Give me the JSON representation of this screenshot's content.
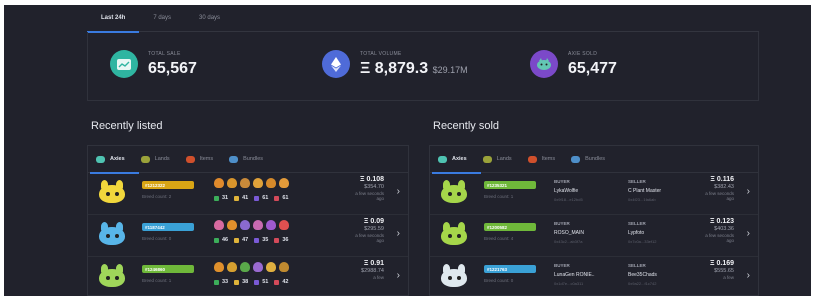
{
  "period_tabs": [
    "Last 24h",
    "7 days",
    "30 days"
  ],
  "stats": [
    {
      "label": "TOTAL SALE",
      "value": "65,567",
      "sub": "",
      "icon": "chart-icon",
      "color": "#2fb5a1"
    },
    {
      "label": "TOTAL VOLUME",
      "value": "Ξ 8,879.3",
      "sub": "$29.17M",
      "icon": "ethereum-icon",
      "color": "#4f6bd8"
    },
    {
      "label": "AXIE SOLD",
      "value": "65,477",
      "sub": "",
      "icon": "axie-icon",
      "color": "#7b49c9"
    }
  ],
  "recently_listed": {
    "title": "Recently listed",
    "tabs": [
      "Axies",
      "Lands",
      "Items",
      "Bundles"
    ],
    "rows": [
      {
        "badge": "#1212322",
        "badge_color": "#d9a515",
        "breed": "Breed count: 2",
        "stats": [
          "31",
          "41",
          "61",
          "61"
        ],
        "eth": "Ξ 0.108",
        "usd": "$354.70",
        "time": "a few seconds ago",
        "axie_color": "#f1d73c"
      },
      {
        "badge": "#1187442",
        "badge_color": "#3aa1d6",
        "breed": "Breed count: 0",
        "stats": [
          "46",
          "47",
          "35",
          "36"
        ],
        "eth": "Ξ 0.09",
        "usd": "$295.59",
        "time": "a few seconds ago",
        "axie_color": "#58b5e8"
      },
      {
        "badge": "#1246860",
        "badge_color": "#6fb83a",
        "breed": "Breed count: 1",
        "stats": [
          "33",
          "38",
          "51",
          "42"
        ],
        "eth": "Ξ 0.91",
        "usd": "$2988.74",
        "time": "a few",
        "axie_color": "#9fd65a"
      }
    ]
  },
  "recently_sold": {
    "title": "Recently sold",
    "tabs": [
      "Axies",
      "Lands",
      "Items",
      "Bundles"
    ],
    "buyer_label": "BUYER",
    "seller_label": "SELLER",
    "rows": [
      {
        "badge": "#1235321",
        "badge_color": "#6fb83a",
        "breed": "Breed count: 1",
        "buyer": "LykaWolfie",
        "buyer_addr": "0x9f18...e12bd5",
        "seller": "C Plant Master",
        "seller_addr": "0x4f23...1fa6ab",
        "eth": "Ξ 0.116",
        "usd": "$382.43",
        "time": "a few seconds ago",
        "axie_color": "#a5d64a"
      },
      {
        "badge": "#1200582",
        "badge_color": "#6fb83a",
        "breed": "Breed count: 4",
        "buyer": "ROSO_MAIN",
        "buyer_addr": "0x43c2...ab3f7a",
        "seller": "Lypfoto",
        "seller_addr": "0x7c0a...33ef12",
        "eth": "Ξ 0.123",
        "usd": "$403.36",
        "time": "a few seconds ago",
        "axie_color": "#a5d64a"
      },
      {
        "badge": "#1221763",
        "badge_color": "#3aa1d6",
        "breed": "Breed count: 0",
        "buyer": "LunaGen RONIE..",
        "buyer_addr": "0x1d7e...c0a311",
        "seller": "Bee35Chads",
        "seller_addr": "0x9a22...f1c742",
        "eth": "Ξ 0.169",
        "usd": "$555.65",
        "time": "a few",
        "axie_color": "#dfe8ee"
      }
    ]
  }
}
